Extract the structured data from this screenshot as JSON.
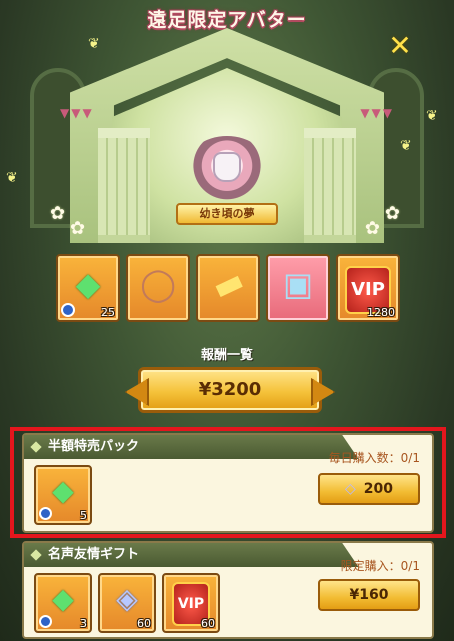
{
  "title": "遠足限定アバター",
  "avatar": {
    "banner": "幼き頃の夢"
  },
  "rewards": [
    {
      "icon": "green-gem-icon",
      "count": "25",
      "timed": true
    },
    {
      "icon": "wreath-ring-icon",
      "count": ""
    },
    {
      "icon": "scroll-banner-icon",
      "count": ""
    },
    {
      "icon": "treasure-chest-icon",
      "count": ""
    },
    {
      "icon": "vip-badge-icon",
      "count": "1280",
      "label": "VIP"
    }
  ],
  "reward_list_label": "報酬一覧",
  "price_button": "¥3200",
  "packs": [
    {
      "name": "半額特売パック",
      "limit": "毎日購入数：0/1",
      "buy_label": "200",
      "buy_currency_icon": "gem-icon",
      "items": [
        {
          "icon": "green-gem-icon",
          "count": "5",
          "timed": true
        }
      ]
    },
    {
      "name": "名声友情ギフト",
      "limit": "限定購入：0/1",
      "buy_label": "¥160",
      "items": [
        {
          "icon": "green-gem-icon",
          "count": "3",
          "timed": true
        },
        {
          "icon": "blue-gem-icon",
          "count": "60"
        },
        {
          "icon": "vip-badge-icon",
          "count": "60",
          "label": "VIP"
        }
      ]
    }
  ]
}
